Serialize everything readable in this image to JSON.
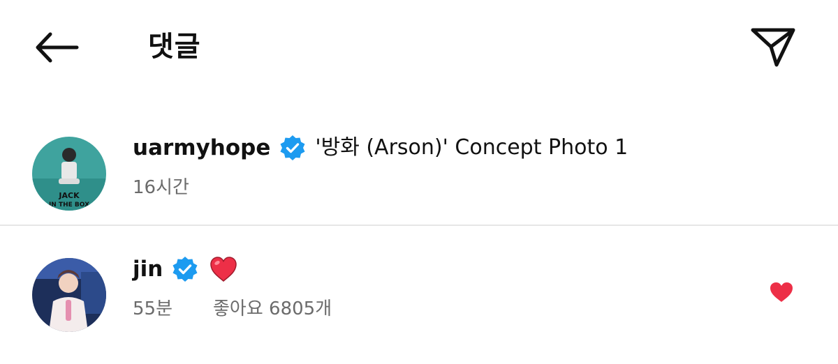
{
  "header": {
    "title": "댓글",
    "back_icon": "arrow-left-icon",
    "share_icon": "paper-plane-icon"
  },
  "caption": {
    "username": "uarmyhope",
    "verified": true,
    "text": "'방화 (Arson)' Concept Photo 1",
    "time": "16시간",
    "avatar_text": "JACK IN THE BOX"
  },
  "reply": {
    "username": "jin",
    "verified": true,
    "text_emoji": "red-heart-emoji",
    "time": "55분",
    "likes": "좋아요 6805개",
    "liked": true
  },
  "colors": {
    "verified_blue": "#1d9bf0",
    "heart_red": "#ed2f47",
    "meta_gray": "#6b6b6b",
    "divider": "#e6e6e6"
  }
}
